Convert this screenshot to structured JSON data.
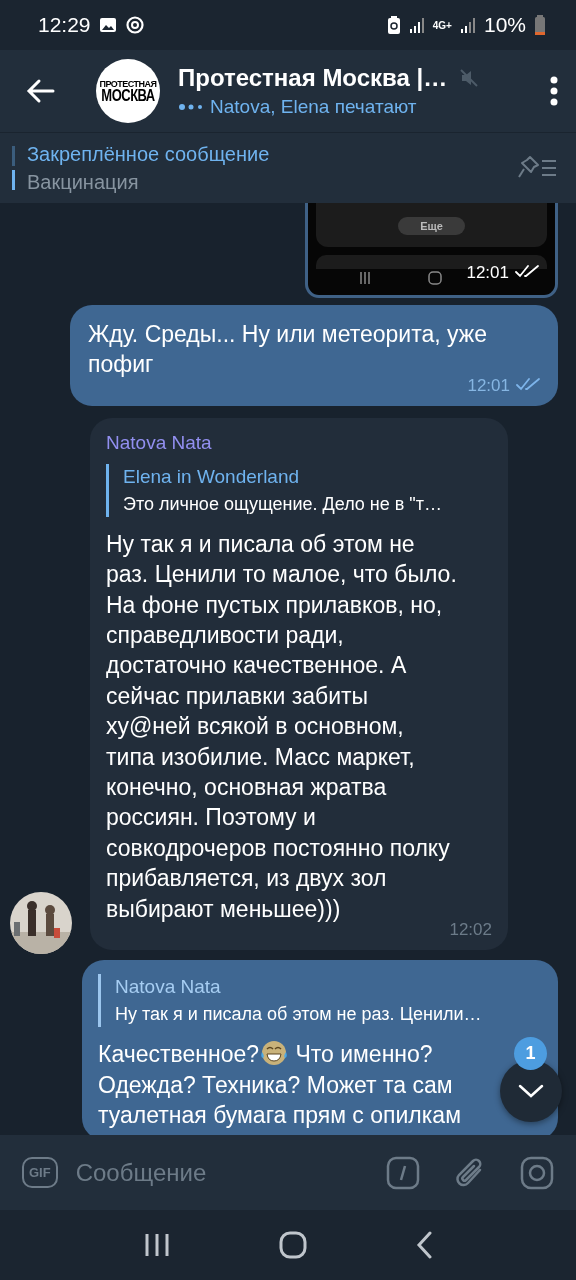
{
  "status_bar": {
    "time": "12:29",
    "network": "4G+",
    "battery": "10%"
  },
  "header": {
    "title": "Протестная Москва |…",
    "muted": true,
    "typing": "Natova, Elena печатают",
    "avatar_lines": [
      "ПРОТЕСТНАЯ",
      "МОСКВА"
    ]
  },
  "pinned": {
    "label": "Закреплённое сообщение",
    "text": "Вакцинация"
  },
  "messages": [
    {
      "kind": "screenshot",
      "outgoing": true,
      "button": "Еще",
      "time": "12:01",
      "read": true
    },
    {
      "kind": "text",
      "outgoing": true,
      "text": "Жду. Среды... Ну или метеорита, уже пофиг",
      "time": "12:01",
      "read": true
    },
    {
      "kind": "text",
      "outgoing": false,
      "sender": "Natova Nata",
      "reply": {
        "author": "Elena in Wonderland",
        "text": "Это личное ощущение. Дело не в \"т…"
      },
      "text": "Ну так я и писала об этом не раз. Ценили то малое, что было. На фоне пустых прилавков, но, справедливости ради, достаточно качественное. А сейчас прилавки забиты ху@ней всякой в основном, типа изобилие. Масс маркет, конечно, основная жратва россиян. Поэтому и совкодрочеров постоянно полку прибавляется, из двух зол выбирают меньшее)))",
      "time": "12:02"
    },
    {
      "kind": "text",
      "outgoing": true,
      "reply": {
        "author": "Natova Nata",
        "text": "Ну так я и писала об этом не раз. Ценили…"
      },
      "lead": "Качественное?",
      "lines": [
        "Что именно?",
        "Одежда? Техника? Может та сам",
        "туалетная бумага прям с опилкам"
      ]
    }
  ],
  "scroll_button": {
    "badge": "1"
  },
  "composer": {
    "gif": "GIF",
    "placeholder": "Сообщение"
  }
}
